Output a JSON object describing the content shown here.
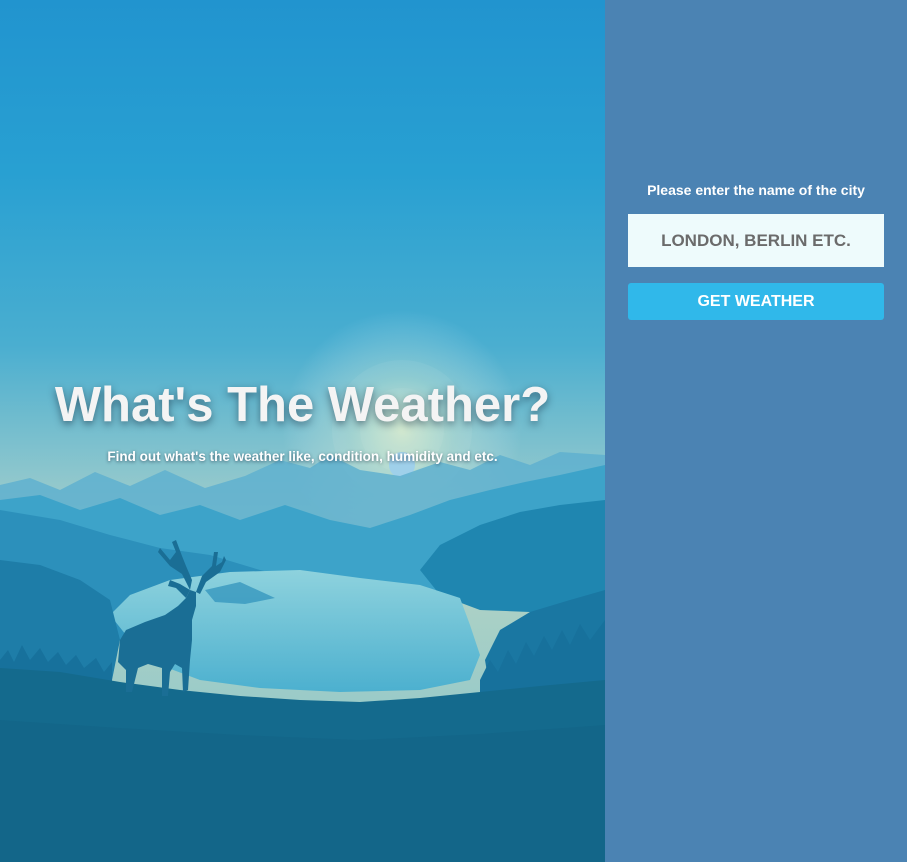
{
  "hero": {
    "title": "What's The Weather?",
    "subtitle": "Find out what's the weather like, condition, humidity and etc."
  },
  "form": {
    "label": "Please enter the name of the city",
    "city_input": {
      "placeholder": "LONDON, BERLIN ETC.",
      "value": ""
    },
    "submit_label": "GET WEATHER"
  },
  "icons": {
    "scene": "mountain-lake-deer-illustration"
  },
  "colors": {
    "panel_background": "#4b83b3",
    "input_background": "#eefbfc",
    "button_background": "#30b8ea",
    "sky_top": "#2196cf",
    "sky_horizon": "#a9cfcf",
    "foreground": "#146a8d"
  }
}
